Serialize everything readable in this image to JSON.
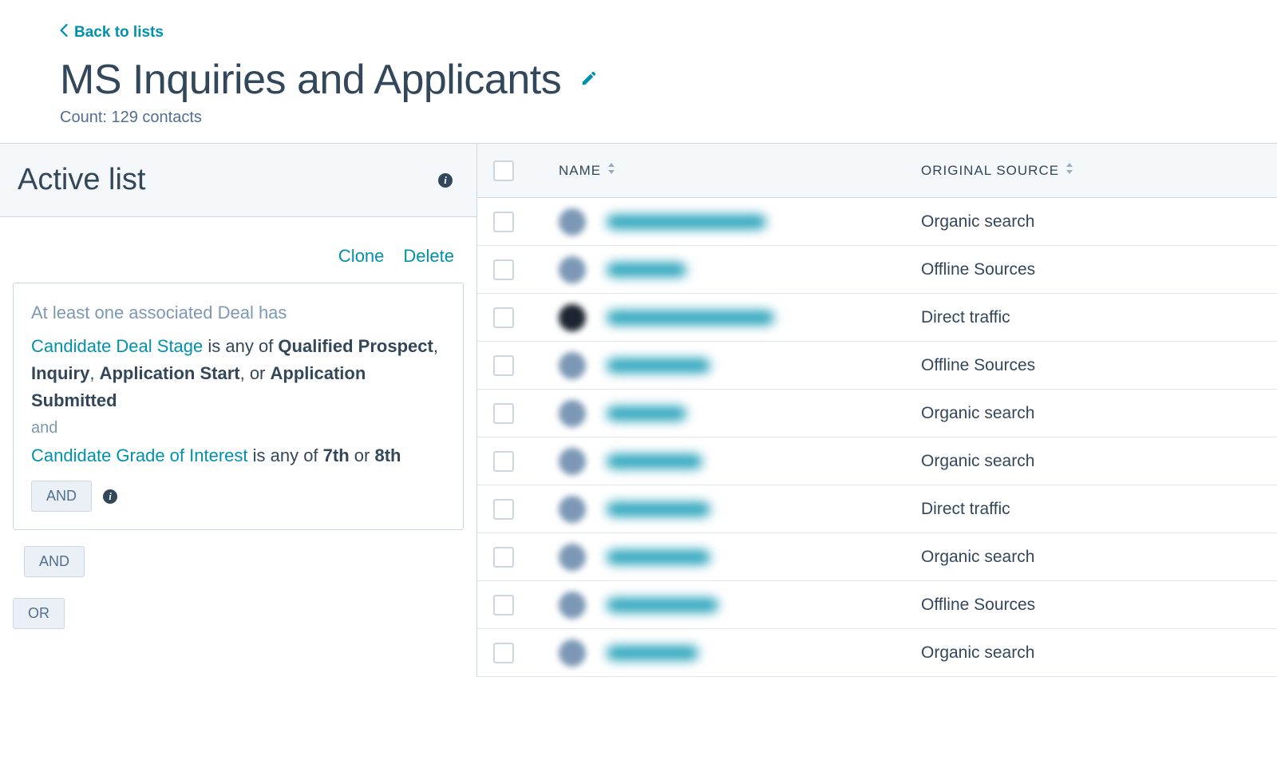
{
  "back_label": "Back to lists",
  "title": "MS Inquiries and Applicants",
  "count_label": "Count: 129 contacts",
  "panel_title": "Active list",
  "actions": {
    "clone": "Clone",
    "delete": "Delete"
  },
  "filter": {
    "intro": "At least one associated Deal has",
    "prop1": "Candidate Deal Stage",
    "pred1": " is any of ",
    "vals1": [
      "Qualified Prospect",
      "Inquiry",
      "Application Start",
      "Application Submitted"
    ],
    "conj": "and",
    "prop2": "Candidate Grade of Interest",
    "pred2": " is any of ",
    "vals2": [
      "7th",
      "8th"
    ]
  },
  "buttons": {
    "and": "AND",
    "or": "OR"
  },
  "columns": {
    "name": "NAME",
    "source": "ORIGINAL SOURCE"
  },
  "rows": [
    {
      "source": "Organic search",
      "nameWidth": 200,
      "dark": false
    },
    {
      "source": "Offline Sources",
      "nameWidth": 100,
      "dark": false
    },
    {
      "source": "Direct traffic",
      "nameWidth": 210,
      "dark": true
    },
    {
      "source": "Offline Sources",
      "nameWidth": 130,
      "dark": false
    },
    {
      "source": "Organic search",
      "nameWidth": 100,
      "dark": false
    },
    {
      "source": "Organic search",
      "nameWidth": 120,
      "dark": false
    },
    {
      "source": "Direct traffic",
      "nameWidth": 130,
      "dark": false
    },
    {
      "source": "Organic search",
      "nameWidth": 130,
      "dark": false
    },
    {
      "source": "Offline Sources",
      "nameWidth": 140,
      "dark": false
    },
    {
      "source": "Organic search",
      "nameWidth": 115,
      "dark": false
    }
  ]
}
